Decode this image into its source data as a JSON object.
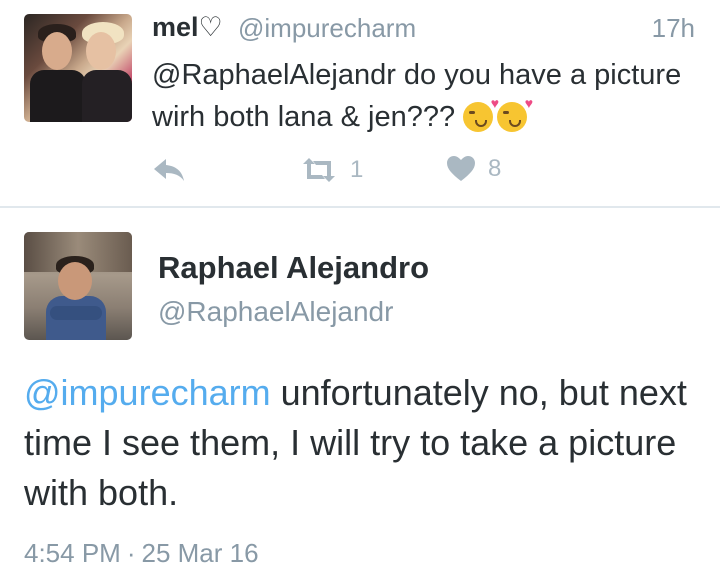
{
  "reply_tweet": {
    "author_name": "mel",
    "name_heart": "♡",
    "handle": "@impurecharm",
    "time": "17h",
    "text": "@RaphaelAlejandr do you have a picture wirh both lana & jen???",
    "emojis": [
      "kissing-face-with-heart",
      "kissing-face-with-heart"
    ],
    "actions": {
      "reply_icon": "reply-arrow-icon",
      "retweet_icon": "retweet-icon",
      "retweet_count": "1",
      "like_icon": "heart-icon",
      "like_count": "8"
    }
  },
  "main_tweet": {
    "author_name": "Raphael Alejandro",
    "handle": "@RaphaelAlejandr",
    "mention": "@impurecharm",
    "text": " unfortunately no, but next time I see them, I will try to take a picture with both.",
    "time": "4:54 PM",
    "separator": "·",
    "date": "25 Mar 16"
  },
  "colors": {
    "text": "#292f33",
    "muted": "#8899a6",
    "icon": "#aab8c2",
    "link": "#55acee",
    "divider": "#e1e8ed"
  }
}
